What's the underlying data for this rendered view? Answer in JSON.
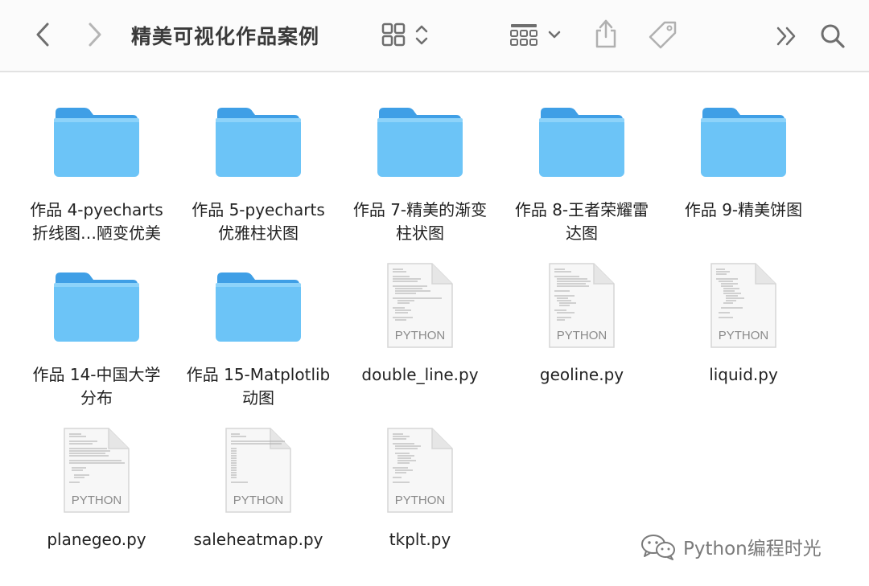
{
  "window": {
    "title": "精美可视化作品案例"
  },
  "toolbar": {
    "back_icon": "chevron-left-icon",
    "forward_icon": "chevron-right-icon",
    "view_icon": "grid-view-icon",
    "group_icon": "group-by-icon",
    "share_icon": "share-icon",
    "tag_icon": "tag-icon",
    "more_icon": "double-chevron-icon",
    "search_icon": "search-icon"
  },
  "items": [
    {
      "kind": "folder",
      "label": "作品 4-pyecharts\n折线图…陋变优美"
    },
    {
      "kind": "folder",
      "label": "作品 5-pyecharts\n优雅柱状图"
    },
    {
      "kind": "folder",
      "label": "作品 7-精美的渐变\n柱状图"
    },
    {
      "kind": "folder",
      "label": "作品 8-王者荣耀雷\n达图"
    },
    {
      "kind": "folder",
      "label": "作品 9-精美饼图"
    },
    {
      "kind": "folder",
      "label": "作品 14-中国大学\n分布"
    },
    {
      "kind": "folder",
      "label": "作品 15-Matplotlib\n动图"
    },
    {
      "kind": "python",
      "label": "double_line.py",
      "badge": "PYTHON"
    },
    {
      "kind": "python",
      "label": "geoline.py",
      "badge": "PYTHON"
    },
    {
      "kind": "python",
      "label": "liquid.py",
      "badge": "PYTHON"
    },
    {
      "kind": "python",
      "label": "planegeo.py",
      "badge": "PYTHON"
    },
    {
      "kind": "python",
      "label": "saleheatmap.py",
      "badge": "PYTHON"
    },
    {
      "kind": "python",
      "label": "tkplt.py",
      "badge": "PYTHON"
    }
  ],
  "watermark": {
    "text": "Python编程时光",
    "logo": "wechat-logo-icon"
  },
  "colors": {
    "folder_front": "#6cc4f7",
    "folder_back": "#3f9fe6",
    "toolbar_icon": "#8a8a8a",
    "title_text": "#3a3a3a"
  }
}
